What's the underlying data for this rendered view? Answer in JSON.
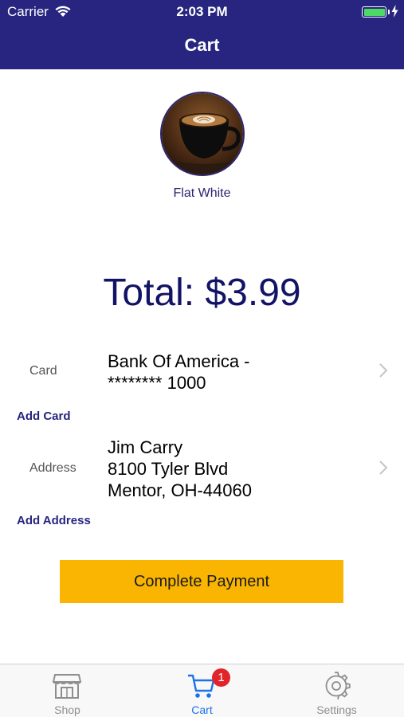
{
  "status_bar": {
    "carrier": "Carrier",
    "time": "2:03 PM"
  },
  "nav": {
    "title": "Cart"
  },
  "item": {
    "name": "Flat White",
    "image_icon": "coffee-cup-latte-art"
  },
  "total": "Total: $3.99",
  "card": {
    "label": "Card",
    "value_line1": "Bank Of America -",
    "value_line2": "******** 1000",
    "add_link": "Add Card"
  },
  "address": {
    "label": "Address",
    "line1": "Jim Carry",
    "line2": "8100 Tyler Blvd",
    "line3": "Mentor, OH-44060",
    "add_link": "Add Address"
  },
  "payment_button": "Complete Payment",
  "tabs": [
    {
      "label": "Shop",
      "icon": "store-icon"
    },
    {
      "label": "Cart",
      "icon": "cart-icon",
      "badge": "1"
    },
    {
      "label": "Settings",
      "icon": "gear-icon"
    }
  ],
  "colors": {
    "nav_bar": "#27257f",
    "accent": "#2b2470",
    "button": "#f9b501",
    "tab_active": "#1a73e8",
    "tab_inactive": "#8e8e8e",
    "badge": "#e0242a"
  }
}
